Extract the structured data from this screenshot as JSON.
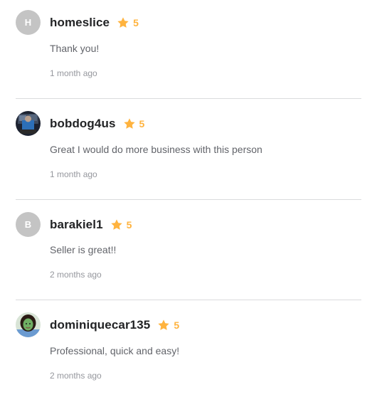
{
  "reviews": [
    {
      "username": "homeslice",
      "avatar_letter": "H",
      "avatar_type": "letter",
      "rating": "5",
      "comment": "Thank you!",
      "time": "1 month ago"
    },
    {
      "username": "bobdog4us",
      "avatar_type": "photo",
      "rating": "5",
      "comment": "Great I would do more business with this person",
      "time": "1 month ago"
    },
    {
      "username": "barakiel1",
      "avatar_letter": "B",
      "avatar_type": "letter",
      "rating": "5",
      "comment": "Seller is great!!",
      "time": "2 months ago"
    },
    {
      "username": "dominiquecar135",
      "avatar_type": "photo",
      "rating": "5",
      "comment": "Professional, quick and easy!",
      "time": "2 months ago"
    }
  ],
  "colors": {
    "star": "#ffb33e",
    "username": "#222325",
    "comment": "#62646a",
    "timestamp": "#95979d",
    "divider": "#dadbdd",
    "avatar_placeholder": "#c4c4c4"
  },
  "icons": {
    "rating": "star-icon"
  }
}
